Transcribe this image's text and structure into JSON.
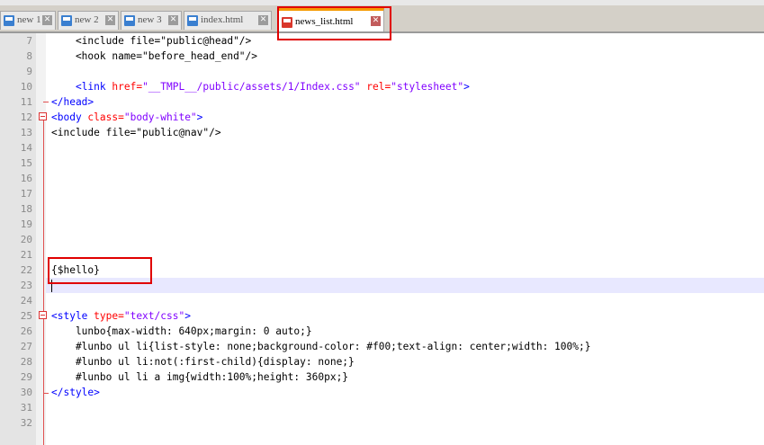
{
  "tabs": [
    {
      "label": "new 1",
      "icon": "file-icon",
      "active": false
    },
    {
      "label": "new 2",
      "icon": "file-icon",
      "active": false
    },
    {
      "label": "new 3",
      "icon": "file-icon",
      "active": false
    },
    {
      "label": "index.html",
      "icon": "file-icon",
      "active": false
    },
    {
      "label": "news_list.html",
      "icon": "file-modified-icon",
      "active": true
    }
  ],
  "close_glyph": "✕",
  "colors": {
    "tag": "#0000ff",
    "attribute": "#ff0000",
    "value": "#8000ff",
    "highlight_box": "#e00000",
    "current_line": "#e8e8ff"
  },
  "lines": {
    "l7": {
      "num": "7",
      "text": "    <include file=\"public@head\"/>"
    },
    "l8": {
      "num": "8",
      "text": "    <hook name=\"before_head_end\"/>"
    },
    "l9": {
      "num": "9",
      "text": ""
    },
    "l10": {
      "num": "10",
      "indent": "    ",
      "open": "<link",
      "attr1": " href=",
      "val1": "\"__TMPL__/public/assets/1/Index.css\"",
      "attr2": " rel=",
      "val2": "\"stylesheet\"",
      "close": ">"
    },
    "l11": {
      "num": "11",
      "text": "</head>"
    },
    "l12": {
      "num": "12",
      "open": "<body",
      "attr": " class=",
      "val": "\"body-white\"",
      "close": ">"
    },
    "l13": {
      "num": "13",
      "text": "<include file=\"public@nav\"/>"
    },
    "l14": {
      "num": "14",
      "text": ""
    },
    "l15": {
      "num": "15",
      "text": ""
    },
    "l16": {
      "num": "16",
      "text": ""
    },
    "l17": {
      "num": "17",
      "text": ""
    },
    "l18": {
      "num": "18",
      "text": ""
    },
    "l19": {
      "num": "19",
      "text": ""
    },
    "l20": {
      "num": "20",
      "text": ""
    },
    "l21": {
      "num": "21",
      "text": ""
    },
    "l22": {
      "num": "22",
      "text": "{$hello}"
    },
    "l23": {
      "num": "23",
      "text": ""
    },
    "l24": {
      "num": "24",
      "text": ""
    },
    "l25": {
      "num": "25",
      "open": "<style",
      "attr": " type=",
      "val": "\"text/css\"",
      "close": ">"
    },
    "l26": {
      "num": "26",
      "text": "    lunbo{max-width: 640px;margin: 0 auto;}"
    },
    "l27": {
      "num": "27",
      "text": "    #lunbo ul li{list-style: none;background-color: #f00;text-align: center;width: 100%;}"
    },
    "l28": {
      "num": "28",
      "text": "    #lunbo ul li:not(:first-child){display: none;}"
    },
    "l29": {
      "num": "29",
      "text": "    #lunbo ul li a img{width:100%;height: 360px;}"
    },
    "l30": {
      "num": "30",
      "text": "</style>"
    },
    "l31": {
      "num": "31",
      "text": ""
    },
    "l32": {
      "num": "32",
      "text": ""
    }
  }
}
